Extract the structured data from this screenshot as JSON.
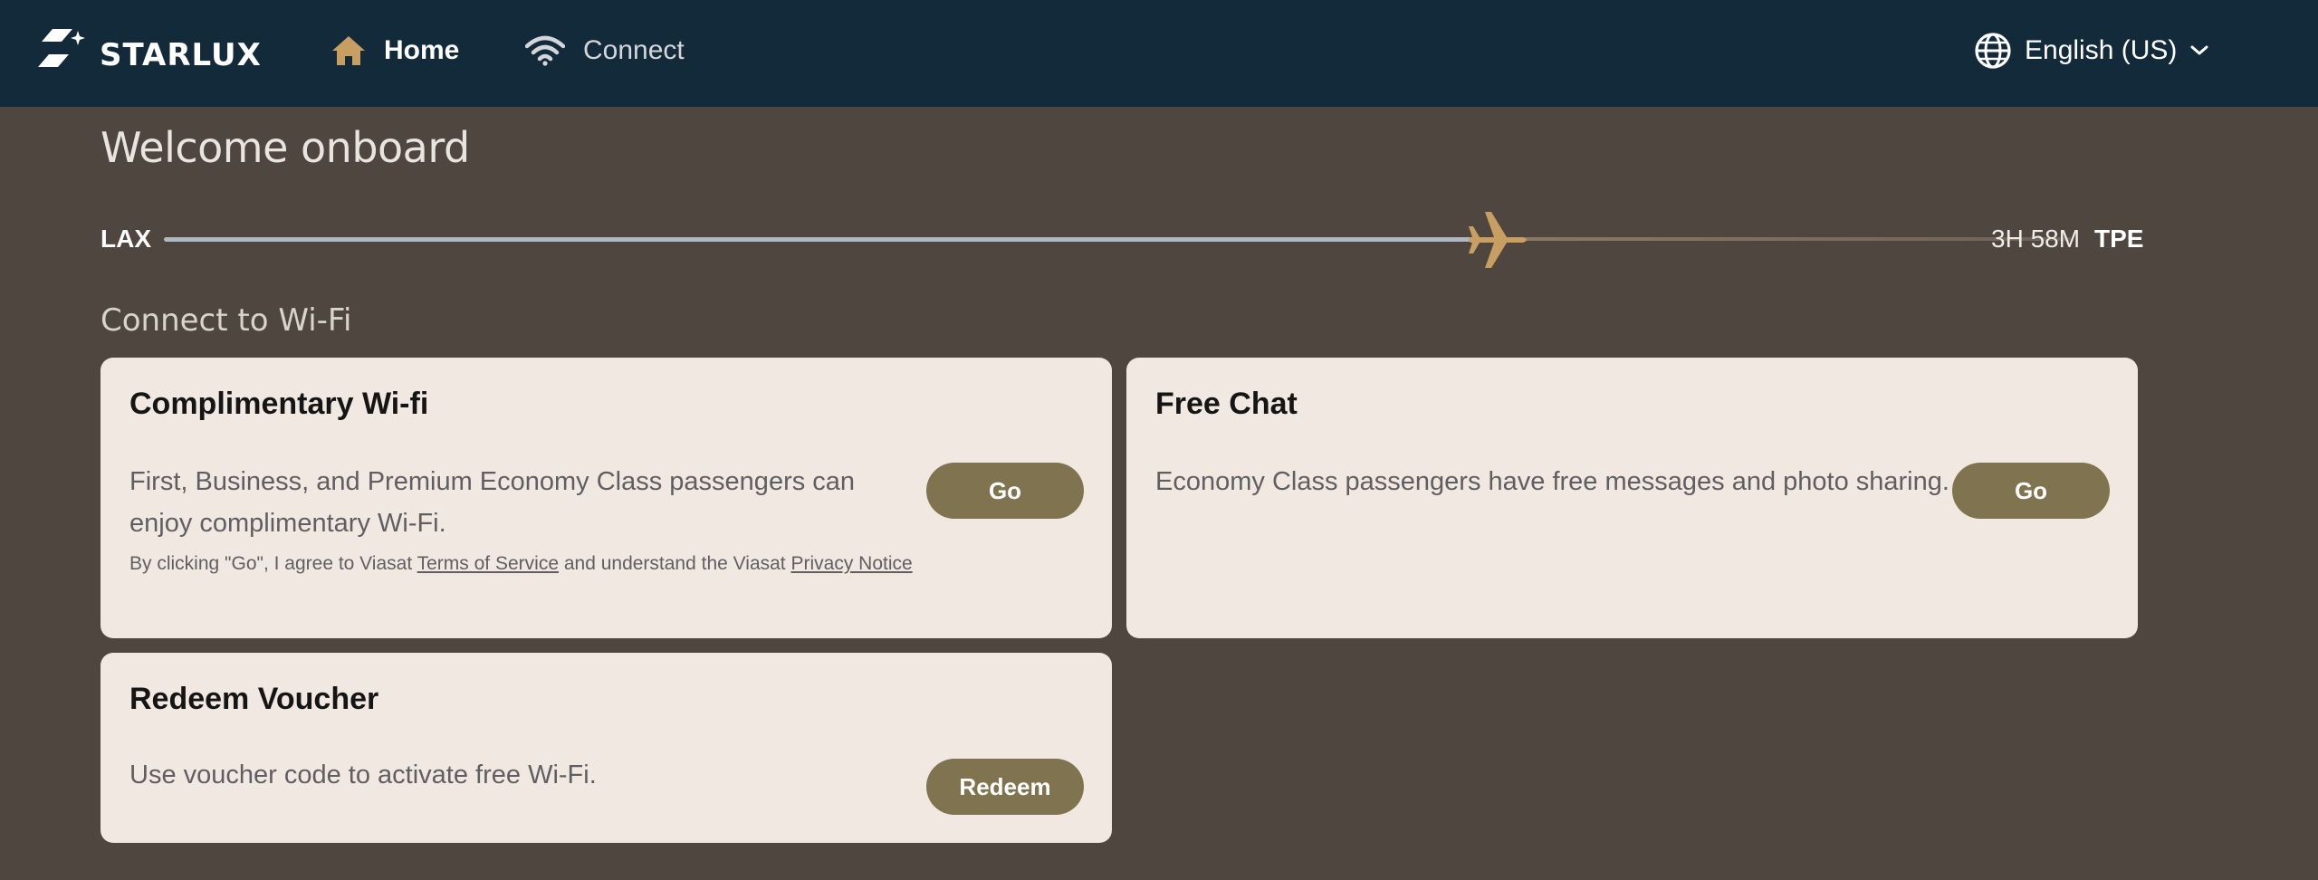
{
  "header": {
    "brand": "STARLUX",
    "nav": [
      {
        "label": "Home",
        "icon": "home-icon",
        "active": true
      },
      {
        "label": "Connect",
        "icon": "wifi-icon",
        "active": false
      }
    ],
    "language": "English (US)"
  },
  "welcome": "Welcome onboard",
  "flight": {
    "origin": "LAX",
    "destination": "TPE",
    "remaining": "3H 58M",
    "progress": 0.7
  },
  "section": {
    "title": "Connect to Wi-Fi"
  },
  "cards": [
    {
      "title": "Complimentary Wi-fi",
      "description": "First, Business, and Premium Economy Class passengers can enjoy complimentary Wi-Fi.",
      "note_prefix": "By clicking \"Go\", I agree to Viasat ",
      "note_terms": "Terms of Service",
      "note_middle": " and understand the Viasat ",
      "note_privacy": "Privacy Notice",
      "button": "Go"
    },
    {
      "title": "Free Chat",
      "description": "Economy Class passengers have free messages and photo sharing.",
      "button": "Go"
    },
    {
      "title": "Redeem Voucher",
      "description": "Use voucher code to activate free Wi-Fi.",
      "button": "Redeem"
    }
  ],
  "colors": {
    "header_bg": "#132a3a",
    "page_bg": "#4f4640",
    "card_bg": "#f1e9e1",
    "button_bg": "#7f744f",
    "accent_gold": "#c79f62"
  }
}
